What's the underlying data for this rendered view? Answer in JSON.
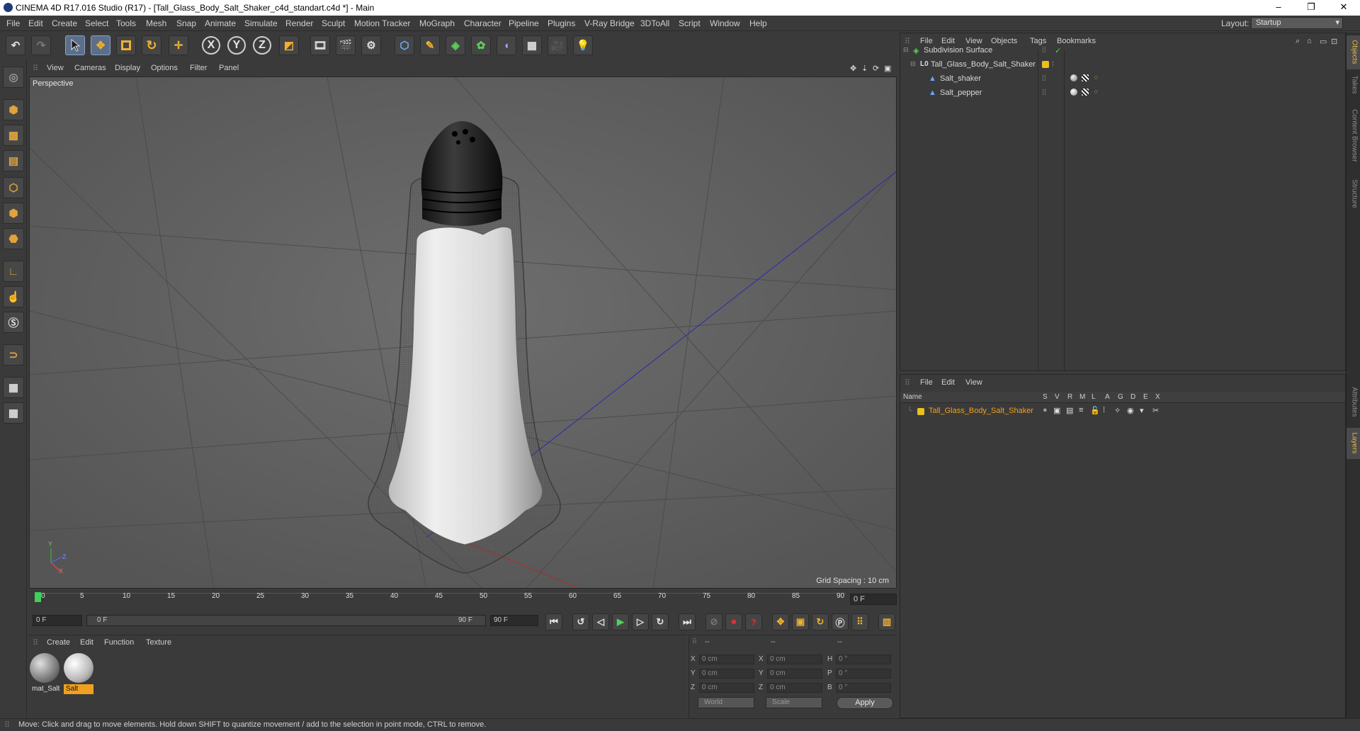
{
  "window": {
    "title": "CINEMA 4D R17.016 Studio (R17) - [Tall_Glass_Body_Salt_Shaker_c4d_standart.c4d *] - Main",
    "minimize": "–",
    "maximize": "❐",
    "close": "✕"
  },
  "menubar": {
    "items": [
      "File",
      "Edit",
      "Create",
      "Select",
      "Tools",
      "Mesh",
      "Snap",
      "Animate",
      "Simulate",
      "Render",
      "Sculpt",
      "Motion Tracker",
      "MoGraph",
      "Character",
      "Pipeline",
      "Plugins",
      "V-Ray Bridge",
      "3DToAll",
      "Script",
      "Window",
      "Help"
    ],
    "layout_label": "Layout:",
    "layout_value": "Startup"
  },
  "toolbar": {
    "x_label": "X",
    "y_label": "Y",
    "z_label": "Z"
  },
  "viewport": {
    "menu": [
      "View",
      "Cameras",
      "Display",
      "Options",
      "Filter",
      "Panel"
    ],
    "camera_label": "Perspective",
    "grid_spacing": "Grid Spacing : 10 cm",
    "axis_labels": {
      "y": "Y",
      "z": "Z",
      "x": "X"
    }
  },
  "timeline": {
    "ticks": [
      "0",
      "5",
      "10",
      "15",
      "20",
      "25",
      "30",
      "35",
      "40",
      "45",
      "50",
      "55",
      "60",
      "65",
      "70",
      "75",
      "80",
      "85",
      "90"
    ],
    "current_frame": "0 F",
    "start_field": "0 F",
    "range_start": "0 F",
    "range_end": "90 F",
    "end_field": "90 F"
  },
  "material_manager": {
    "menu": [
      "Create",
      "Edit",
      "Function",
      "Texture"
    ],
    "materials": [
      {
        "name": "mat_Salt",
        "selected": false
      },
      {
        "name": "Salt",
        "selected": true
      }
    ]
  },
  "coordinates": {
    "headers": [
      "--",
      "--",
      "--"
    ],
    "rows": [
      {
        "axis": "X",
        "pos": "0 cm",
        "size_axis": "X",
        "size": "0 cm",
        "rot_axis": "H",
        "rot": "0 °"
      },
      {
        "axis": "Y",
        "pos": "0 cm",
        "size_axis": "Y",
        "size": "0 cm",
        "rot_axis": "P",
        "rot": "0 °"
      },
      {
        "axis": "Z",
        "pos": "0 cm",
        "size_axis": "Z",
        "size": "0 cm",
        "rot_axis": "B",
        "rot": "0 °"
      }
    ],
    "space_mode": "World",
    "size_mode": "Scale",
    "apply_label": "Apply"
  },
  "object_manager": {
    "menu": [
      "File",
      "Edit",
      "View",
      "Objects",
      "Tags",
      "Bookmarks"
    ],
    "objects": [
      {
        "name": "Subdivision Surface",
        "indent": 0
      },
      {
        "name": "Tall_Glass_Body_Salt_Shaker",
        "indent": 1
      },
      {
        "name": "Salt_shaker",
        "indent": 2
      },
      {
        "name": "Salt_pepper",
        "indent": 2
      }
    ]
  },
  "layer_manager": {
    "menu": [
      "File",
      "Edit",
      "View"
    ],
    "columns": [
      "Name",
      "S",
      "V",
      "R",
      "M",
      "L",
      "A",
      "G",
      "D",
      "E",
      "X"
    ],
    "layers": [
      {
        "name": "Tall_Glass_Body_Salt_Shaker",
        "color": "#e8c020"
      }
    ]
  },
  "right_tabs": [
    "Objects",
    "Takes",
    "Content Browser",
    "Structure",
    "Attributes",
    "Layers"
  ],
  "status": "Move: Click and drag to move elements. Hold down SHIFT to quantize movement / add to the selection in point mode, CTRL to remove.",
  "colors": {
    "accent": "#e8a830",
    "selected_material": "#f0a020",
    "layer_color": "#e8c020"
  }
}
